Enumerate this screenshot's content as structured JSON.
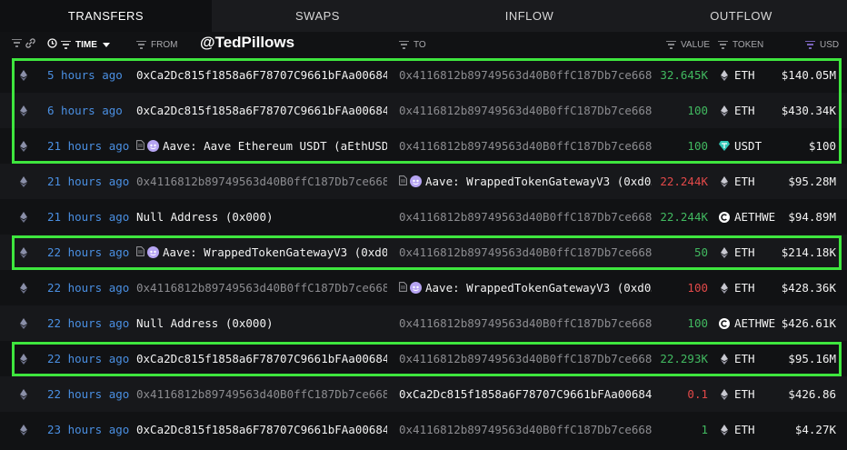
{
  "tabs": [
    {
      "label": "TRANSFERS",
      "active": true
    },
    {
      "label": "SWAPS",
      "active": false
    },
    {
      "label": "INFLOW",
      "active": false
    },
    {
      "label": "OUTFLOW",
      "active": false
    }
  ],
  "columns": {
    "time": "TIME",
    "from": "FROM",
    "to": "TO",
    "value": "VALUE",
    "token": "TOKEN",
    "usd": "USD"
  },
  "watermark": "@TedPillows",
  "colors": {
    "accent_time": "#4a8fe2",
    "positive": "#41b960",
    "negative": "#e24949",
    "highlight": "#3ee63e"
  },
  "rows": [
    {
      "time": "5 hours ago",
      "from": "0xCa2Dc815f1858a6F78707C9661bFAa00684…",
      "from_entity": false,
      "to": "0x4116812b89749563d40B0ffC187Db7ce668…",
      "to_entity": false,
      "value": "32.645K",
      "value_sign": "pos",
      "token": "ETH",
      "token_icon": "eth-icon",
      "usd": "$140.05M",
      "highlighted": true
    },
    {
      "time": "6 hours ago",
      "from": "0xCa2Dc815f1858a6F78707C9661bFAa00684…",
      "from_entity": false,
      "to": "0x4116812b89749563d40B0ffC187Db7ce668…",
      "to_entity": false,
      "value": "100",
      "value_sign": "pos",
      "token": "ETH",
      "token_icon": "eth-icon",
      "usd": "$430.34K",
      "highlighted": true
    },
    {
      "time": "21 hours ago",
      "from": "Aave: Aave Ethereum USDT (aEthUSD…",
      "from_entity": true,
      "to": "0x4116812b89749563d40B0ffC187Db7ce668…",
      "to_entity": false,
      "value": "100",
      "value_sign": "pos",
      "token": "USDT",
      "token_icon": "usdt-icon",
      "usd": "$100",
      "highlighted": true
    },
    {
      "time": "21 hours ago",
      "from": "0x4116812b89749563d40B0ffC187Db7ce668…",
      "from_entity": false,
      "to": "Aave: WrappedTokenGatewayV3 (0xd0…",
      "to_entity": true,
      "value": "22.244K",
      "value_sign": "neg",
      "token": "ETH",
      "token_icon": "eth-icon",
      "usd": "$95.28M",
      "highlighted": false
    },
    {
      "time": "21 hours ago",
      "from": "Null Address (0x000)",
      "from_entity": false,
      "to": "0x4116812b89749563d40B0ffC187Db7ce668…",
      "to_entity": false,
      "value": "22.244K",
      "value_sign": "pos",
      "token": "AETHWE",
      "token_icon": "aethwe-icon",
      "usd": "$94.89M",
      "highlighted": false
    },
    {
      "time": "22 hours ago",
      "from": "Aave: WrappedTokenGatewayV3 (0xd0…",
      "from_entity": true,
      "to": "0x4116812b89749563d40B0ffC187Db7ce668…",
      "to_entity": false,
      "value": "50",
      "value_sign": "pos",
      "token": "ETH",
      "token_icon": "eth-icon",
      "usd": "$214.18K",
      "highlighted": true
    },
    {
      "time": "22 hours ago",
      "from": "0x4116812b89749563d40B0ffC187Db7ce668…",
      "from_entity": false,
      "to": "Aave: WrappedTokenGatewayV3 (0xd0…",
      "to_entity": true,
      "value": "100",
      "value_sign": "neg",
      "token": "ETH",
      "token_icon": "eth-icon",
      "usd": "$428.36K",
      "highlighted": false
    },
    {
      "time": "22 hours ago",
      "from": "Null Address (0x000)",
      "from_entity": false,
      "to": "0x4116812b89749563d40B0ffC187Db7ce668…",
      "to_entity": false,
      "value": "100",
      "value_sign": "pos",
      "token": "AETHWE",
      "token_icon": "aethwe-icon",
      "usd": "$426.61K",
      "highlighted": false
    },
    {
      "time": "22 hours ago",
      "from": "0xCa2Dc815f1858a6F78707C9661bFAa00684…",
      "from_entity": false,
      "to": "0x4116812b89749563d40B0ffC187Db7ce668…",
      "to_entity": false,
      "value": "22.293K",
      "value_sign": "pos",
      "token": "ETH",
      "token_icon": "eth-icon",
      "usd": "$95.16M",
      "highlighted": true
    },
    {
      "time": "22 hours ago",
      "from": "0x4116812b89749563d40B0ffC187Db7ce668…",
      "from_entity": false,
      "to": "0xCa2Dc815f1858a6F78707C9661bFAa00684…",
      "to_entity": false,
      "value": "0.1",
      "value_sign": "neg",
      "token": "ETH",
      "token_icon": "eth-icon",
      "usd": "$426.86",
      "highlighted": false
    },
    {
      "time": "23 hours ago",
      "from": "0xCa2Dc815f1858a6F78707C9661bFAa00684…",
      "from_entity": false,
      "to": "0x4116812b89749563d40B0ffC187Db7ce668…",
      "to_entity": false,
      "value": "1",
      "value_sign": "pos",
      "token": "ETH",
      "token_icon": "eth-icon",
      "usd": "$4.27K",
      "highlighted": false
    }
  ]
}
